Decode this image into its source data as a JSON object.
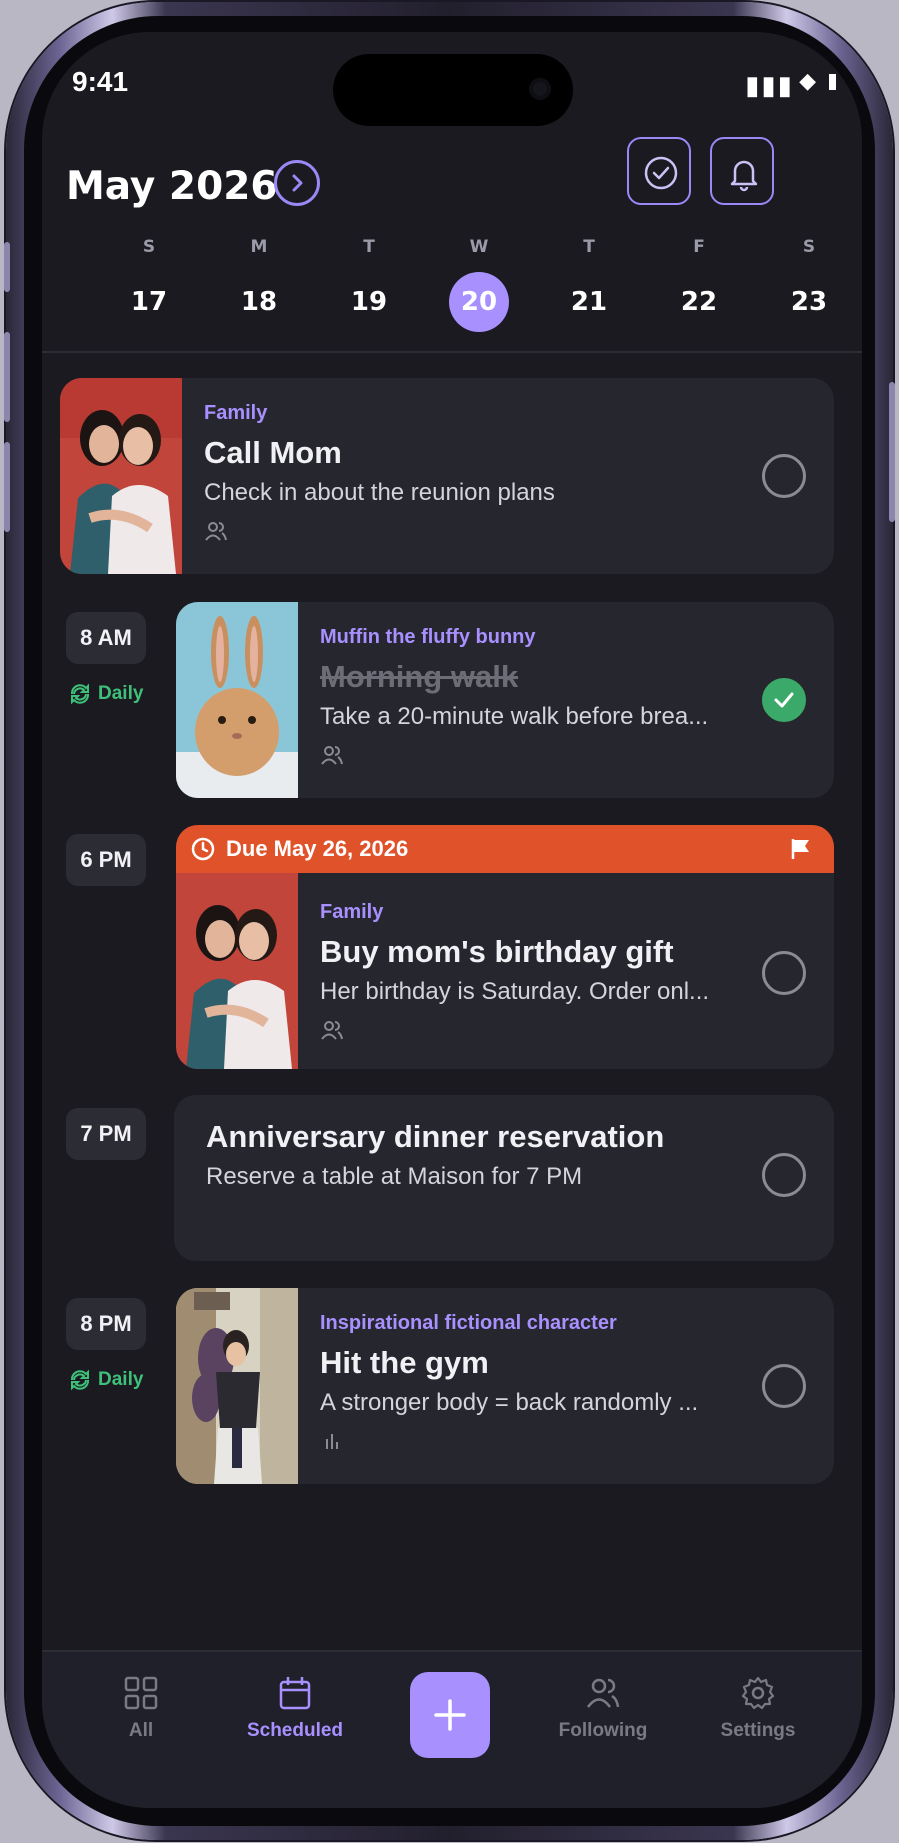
{
  "status_bar": {
    "time": "9:41"
  },
  "header": {
    "month_title": "May 2026"
  },
  "week": {
    "days": [
      {
        "dow": "S",
        "num": "17"
      },
      {
        "dow": "M",
        "num": "18"
      },
      {
        "dow": "T",
        "num": "19"
      },
      {
        "dow": "W",
        "num": "20",
        "selected": true
      },
      {
        "dow": "T",
        "num": "21"
      },
      {
        "dow": "F",
        "num": "22"
      },
      {
        "dow": "S",
        "num": "23"
      }
    ]
  },
  "tasks": [
    {
      "category": "Family",
      "title": "Call Mom",
      "description": "Check in about the reunion plans",
      "meta_icon": "people-icon",
      "done": false,
      "time": "",
      "thumb": "mother-daughter-photo"
    },
    {
      "time": "8 AM",
      "repeat": "Daily",
      "category": "Muffin the fluffy bunny",
      "title": "Morning walk",
      "description": "Take a 20-minute walk before brea...",
      "meta_icon": "people-icon",
      "done": true,
      "thumb": "bunny-photo"
    },
    {
      "time": "6 PM",
      "due": "Due May 26, 2026",
      "category": "Family",
      "title": "Buy mom's birthday gift",
      "description": "Her birthday is Saturday. Order onl...",
      "meta_icon": "people-icon",
      "done": false,
      "thumb": "mother-daughter-photo"
    },
    {
      "time": "7 PM",
      "title": "Anniversary dinner reservation",
      "description": "Reserve a table at Maison for 7 PM",
      "done": false
    },
    {
      "time": "8 PM",
      "repeat": "Daily",
      "category": "Inspirational fictional character",
      "title": "Hit the gym",
      "description": "A stronger body = back randomly ...",
      "meta_icon": "bar-chart-icon",
      "done": false,
      "thumb": "character-illustration"
    }
  ],
  "nav": {
    "all": "All",
    "scheduled": "Scheduled",
    "following": "Following",
    "settings": "Settings"
  },
  "colors": {
    "accent": "#a990ff",
    "background": "#1a1a20",
    "card": "#26262e",
    "due_bar": "#e0522a",
    "repeat_green": "#3ec07a",
    "done_green": "#3aa96a"
  }
}
